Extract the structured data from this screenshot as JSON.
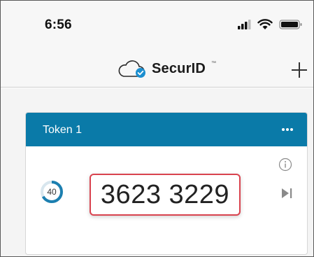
{
  "status_bar": {
    "time": "6:56",
    "icons": [
      "signal-icon",
      "wifi-icon",
      "battery-icon"
    ]
  },
  "nav": {
    "app_title": "SecurID",
    "trademark": "™",
    "logo_icon": "cloud-check-icon",
    "add_icon": "plus-icon"
  },
  "token": {
    "name": "Token 1",
    "menu_icon": "more-dots-icon",
    "info_icon": "info-icon",
    "countdown": "40",
    "countdown_fraction": 0.67,
    "code": "3623 3229",
    "next_icon": "skip-next-icon"
  },
  "colors": {
    "accent": "#0a7aa8",
    "highlight_border": "#d9434f",
    "timer_ring": "#1c7fb0",
    "timer_track": "#d8e6ee"
  }
}
